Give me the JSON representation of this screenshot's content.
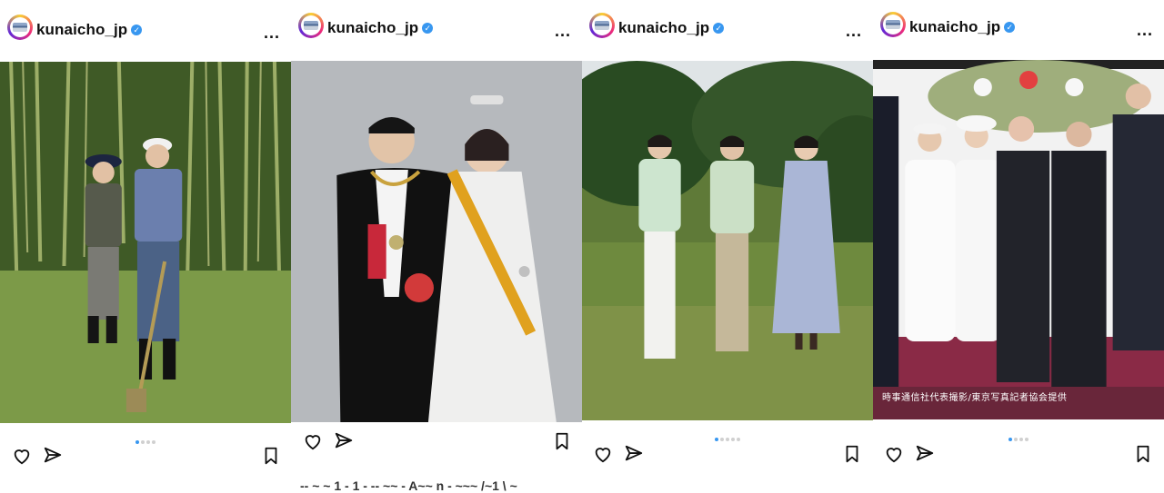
{
  "posts": [
    {
      "username": "kunaicho_jp",
      "more": "...",
      "active_slide": 0,
      "slides": 4,
      "photo": "forest-planting-photo"
    },
    {
      "username": "kunaicho_jp",
      "more": "...",
      "photo": "formal-portrait-photo",
      "caption": "-- ~ ~ 1 - 1 - -- ~~ - A~~ n - ~~~ /~1 \\ ~"
    },
    {
      "username": "kunaicho_jp",
      "more": "...",
      "active_slide": 0,
      "slides": 5,
      "photo": "family-garden-photo"
    },
    {
      "username": "kunaicho_jp",
      "more": "...",
      "active_slide": 0,
      "slides": 4,
      "photo": "state-visit-photo",
      "credit": "時事通信社代表撮影/東京写真記者協会提供"
    }
  ],
  "icons": [
    "heart-icon",
    "send-icon",
    "bookmark-icon",
    "verified-icon",
    "more-icon"
  ],
  "colors": {
    "verified": "#3897f0",
    "active_dot": "#3897f0",
    "inactive_dot": "#d0d0d0"
  }
}
